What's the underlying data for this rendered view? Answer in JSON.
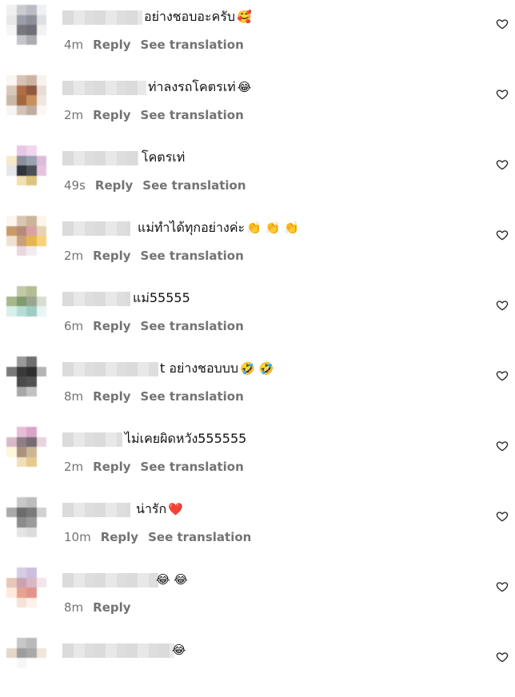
{
  "actions": {
    "reply": "Reply",
    "see_translation": "See translation"
  },
  "comments": [
    {
      "text": "อย่างชอบอะครับ",
      "emoji": "🥰",
      "time": "4m",
      "has_translation": true
    },
    {
      "text": "ท่าลงรถโคตรเท่",
      "emoji": "😂",
      "time": "2m",
      "has_translation": true
    },
    {
      "text": "โคตรเท่",
      "emoji": "",
      "time": "49s",
      "has_translation": true
    },
    {
      "text": "แม่ทำได้ทุกอย่างค่ะ",
      "emoji": "👏 👏 👏",
      "time": "2m",
      "has_translation": true
    },
    {
      "text": "แม่55555",
      "emoji": "",
      "time": "6m",
      "has_translation": true
    },
    {
      "text": "t อย่างชอบบบ",
      "emoji": "🤣 🤣",
      "time": "8m",
      "has_translation": true
    },
    {
      "text": "ไม่เคยผิดหวัง555555",
      "emoji": "",
      "time": "2m",
      "has_translation": true
    },
    {
      "text": "น่ารัก",
      "emoji": "❤️",
      "time": "10m",
      "has_translation": true
    },
    {
      "text": "",
      "emoji": "😂 😂",
      "time": "8m",
      "has_translation": false
    },
    {
      "text": "",
      "emoji": "😂",
      "time": "",
      "has_translation": false
    }
  ],
  "colors": {
    "meta_text": "#737373",
    "body_text": "#111111",
    "heart_stroke": "#262626"
  },
  "icons": {
    "like": "heart-outline-icon"
  }
}
